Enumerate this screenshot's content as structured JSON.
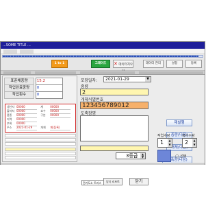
{
  "window": {
    "title": "...SOME TITLE ..."
  },
  "toolbar": {
    "btn_orange_label": "1 to 1",
    "btn_green_label": "그레이드",
    "btn_close_label": "데이터지우기",
    "btn_r1_label": "데이터 관리",
    "btn_r2_label": "설정",
    "btn_r3_label": "등록"
  },
  "left": {
    "total_label": "표준체중량",
    "total_value": "15.2",
    "accum_label": "작업완료중량",
    "accum_value": "0",
    "count_label": "작업횟수",
    "count_value": "0",
    "info_rows": [
      {
        "k": "생산자",
        "v": "00000"
      },
      {
        "k": "출하처",
        "v": "00000"
      },
      {
        "k": "품종",
        "v": "00000"
      },
      {
        "k": "지역",
        "v": "00000"
      },
      {
        "k": "부위",
        "v": "00000"
      },
      {
        "k": "주소",
        "v": "2021-01-29"
      }
    ],
    "info_right": [
      {
        "k": "계",
        "v": "00000"
      },
      {
        "k": "호수",
        "v": "00000"
      },
      {
        "k": "구분",
        "v": "00000"
      },
      {
        "k": "개체",
        "v": "계(등록)"
      }
    ],
    "lines": [
      "",
      "",
      "",
      "",
      "",
      ""
    ]
  },
  "middle": {
    "date_label": "포장일자:",
    "date_value": "2021-01-29",
    "weight_label": "중량",
    "weight_value": "2",
    "id_label": "개체식별번호",
    "id_value": "123456789012",
    "slaughter_label": "도축장명",
    "slaughter_value": "",
    "grade_value": "3등급",
    "select_value": "전기도소 트리스",
    "close_label": "닫기 리프트",
    "cancel_label": "닫기"
  },
  "right": {
    "btn1": "재발행",
    "btn2": "중량(다음)",
    "btn3": "개체(다음)",
    "btn4": "도축장(다음)",
    "print_count_label": "작업수량",
    "print_count_value": "1",
    "copies_label": "복사수량",
    "copies_value": "2",
    "select_label": "선택"
  },
  "progress": 0.98
}
